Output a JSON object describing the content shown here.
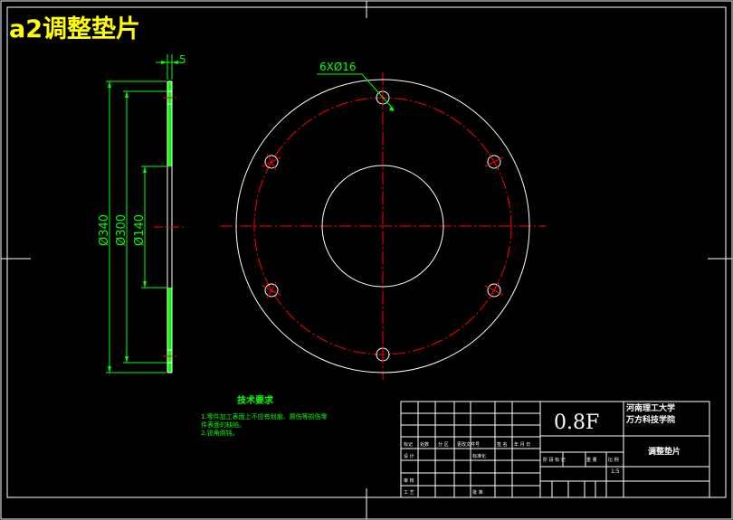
{
  "sheet": {
    "title": "a2调整垫片"
  },
  "dimensions": {
    "thickness": "5",
    "holes": "6XØ16",
    "d340": "Ø340",
    "d300": "Ø300",
    "d140": "Ø140"
  },
  "tech_requirements": {
    "title": "技术要求",
    "lines": [
      "1.零件加工表面上不应有划痕、擦伤等损伤零",
      "  件表面的缺陷。",
      "2.锐角倒钝。"
    ]
  },
  "title_block": {
    "scale_text": "0.8F",
    "school": "河南理工大学万方科技学院",
    "part_name": "调整垫片",
    "ratio": "1:5",
    "small_labels": [
      "标记",
      "处数",
      "分 区",
      "更改文件号",
      "签 名",
      "年 月 日",
      "设 计",
      "标准化",
      "审 核",
      "工 艺",
      "批 准",
      "阶 段 标 记",
      "重 量",
      "比 例"
    ]
  },
  "colors": {
    "background": "#000000",
    "line": "#ffffff",
    "centerline": "#ff0000",
    "dimension": "#00ff00",
    "section_fill": "#00ff00",
    "title": "#ffff00"
  }
}
